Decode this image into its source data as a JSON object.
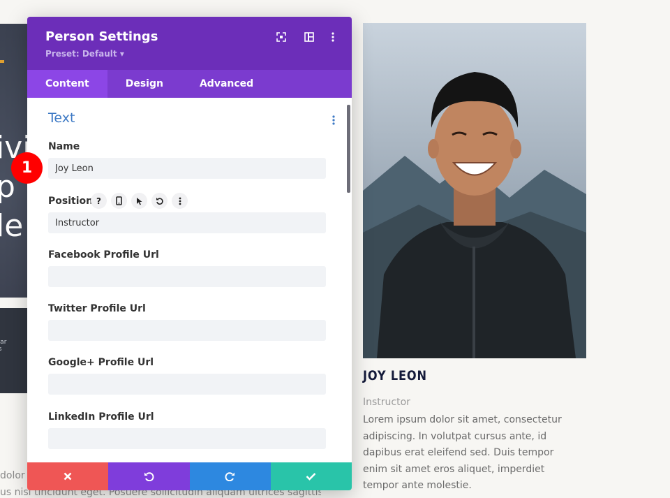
{
  "background": {
    "hero_text": "ivi\np\nle",
    "bar_text": "Bar\nrs\ne",
    "bottom_text_line1": "dolor s",
    "bottom_text_line2": "us nisi tincidunt eget. Posuere sollicitudin aliquam ultrices sagittis. Et",
    "person": {
      "name": "JOY LEON",
      "position": "Instructor",
      "description": "Lorem ipsum dolor sit amet, consectetur adipiscing. In volutpat cursus ante, id dapibus erat eleifend sed. Duis tempor enim sit amet eros aliquet, imperdiet tempor ante molestie."
    }
  },
  "modal": {
    "title": "Person Settings",
    "preset": "Preset: Default ▾",
    "header_icons": [
      "focus-icon",
      "columns-icon",
      "more-vertical-icon"
    ],
    "tabs": [
      {
        "label": "Content",
        "active": true
      },
      {
        "label": "Design",
        "active": false
      },
      {
        "label": "Advanced",
        "active": false
      }
    ],
    "section_title": "Text",
    "fields": {
      "name": {
        "label": "Name",
        "value": "Joy Leon"
      },
      "position": {
        "label": "Position",
        "value": "Instructor",
        "tools": [
          "help-icon",
          "mobile-icon",
          "cursor-icon",
          "reset-icon",
          "more-vertical-icon"
        ]
      },
      "facebook": {
        "label": "Facebook Profile Url",
        "value": ""
      },
      "twitter": {
        "label": "Twitter Profile Url",
        "value": ""
      },
      "google": {
        "label": "Google+ Profile Url",
        "value": ""
      },
      "linkedin": {
        "label": "LinkedIn Profile Url",
        "value": ""
      }
    },
    "footer": [
      "cancel",
      "undo",
      "redo",
      "save"
    ]
  },
  "step_badge": "1",
  "colors": {
    "header": "#6c2eb9",
    "tabs": "#7b3bcf",
    "tab_active": "#8c46e6",
    "section_title": "#3e7ac5",
    "cancel": "#ef5655",
    "undo": "#7f3ddb",
    "redo": "#2d88e0",
    "save": "#29c4a9",
    "badge": "#ff0000"
  }
}
